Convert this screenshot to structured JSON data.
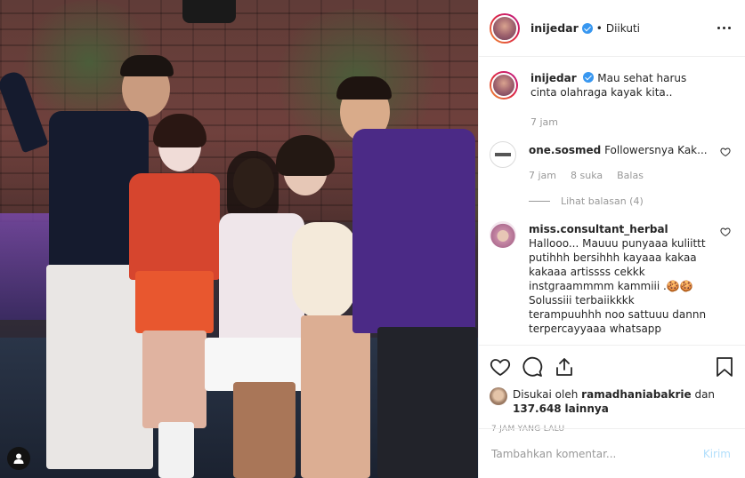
{
  "header": {
    "username": "inijedar",
    "separator": "•",
    "follow_status": "Diikuti"
  },
  "caption": {
    "username": "inijedar",
    "text": "Mau sehat harus cinta olahraga kayak kita..",
    "time": "7 jam"
  },
  "comments": [
    {
      "username": "one.sosmed",
      "text": "Followersnya Kak...",
      "time": "7 jam",
      "likes": "8 suka",
      "reply_label": "Balas",
      "view_replies": "Lihat balasan (4)"
    },
    {
      "username": "miss.consultant_herbal",
      "text": "Hallooo... Mauuu punyaaa kuliittt putihhh bersihhh kayaaa kakaa kakaaa artissss cekkk instgraammmm kammiii .🍪🍪 Solussiii terbaiikkkk terampuuhhh noo sattuuu dannn terpercayyaaa whatsapp"
    }
  ],
  "likes": {
    "prefix": "Disukai oleh",
    "user": "ramadhaniabakrie",
    "and": "dan",
    "count": "137.648",
    "suffix": "lainnya"
  },
  "timestamp": "7 JAM YANG LALU",
  "comment_input": {
    "placeholder": "Tambahkan komentar...",
    "post_label": "Kirim"
  },
  "colors": {
    "verified": "#3897f0",
    "meta_text": "#999999",
    "post_button_disabled": "#b2dffc"
  }
}
